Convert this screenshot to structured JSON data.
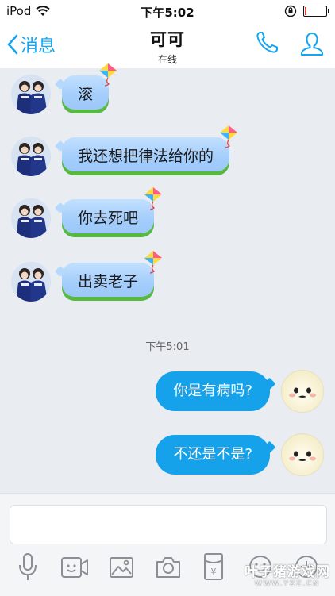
{
  "status_bar": {
    "carrier": "iPod",
    "time": "下午5:02",
    "battery_level": 0.1
  },
  "header": {
    "back_label": "消息",
    "title": "可可",
    "subtitle": "在线"
  },
  "messages_in": [
    {
      "text": "滚"
    },
    {
      "text": "我还想把律法给你的"
    },
    {
      "text": "你去死吧"
    },
    {
      "text": "出卖老子"
    }
  ],
  "timestamp": "下午5:01",
  "messages_out": [
    {
      "text": "你是有病吗?"
    },
    {
      "text": "不还是不是?"
    }
  ],
  "input": {
    "placeholder": ""
  },
  "toolbar": {
    "icons": [
      "microphone-icon",
      "video-icon",
      "image-icon",
      "camera-icon",
      "red-packet-icon",
      "emoji-icon",
      "add-icon"
    ]
  },
  "watermark": {
    "main": "叶子猪游戏网",
    "sub": "WWW.YZZ.CN"
  },
  "colors": {
    "accent": "#15a5ef",
    "out_bubble": "#15a2ea",
    "chat_bg": "#e9ecf0"
  }
}
